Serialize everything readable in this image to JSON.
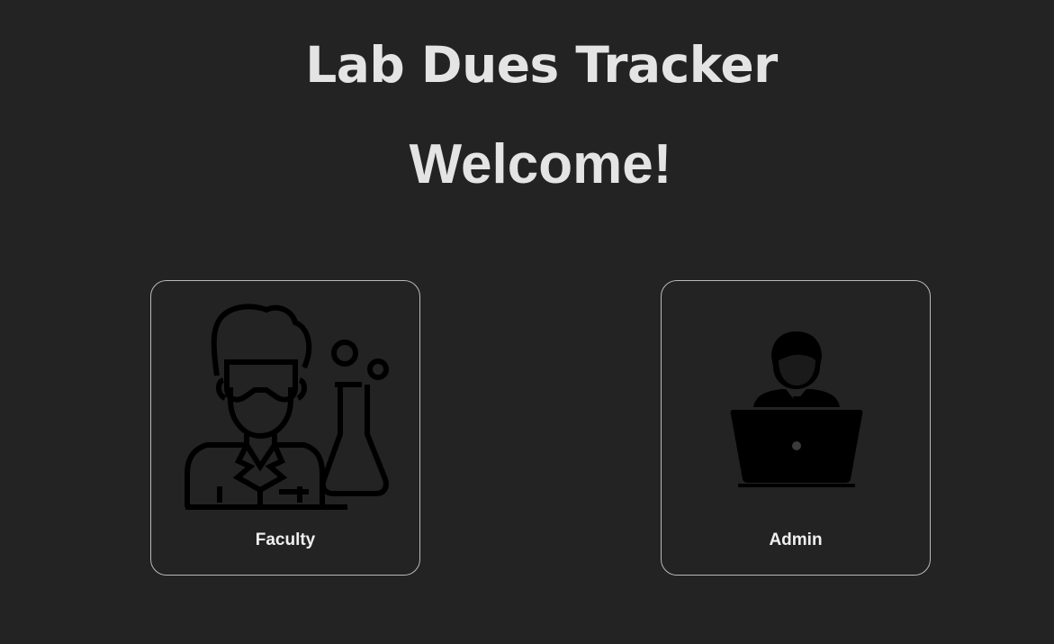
{
  "header": {
    "app_title": "Lab Dues Tracker",
    "welcome": "Welcome!"
  },
  "roles": [
    {
      "label": "Faculty",
      "icon": "scientist-icon"
    },
    {
      "label": "Admin",
      "icon": "admin-laptop-icon"
    }
  ],
  "colors": {
    "background": "#232323",
    "text": "#e4e4e4",
    "card_border": "#b9b9b9",
    "icon": "#000000"
  }
}
